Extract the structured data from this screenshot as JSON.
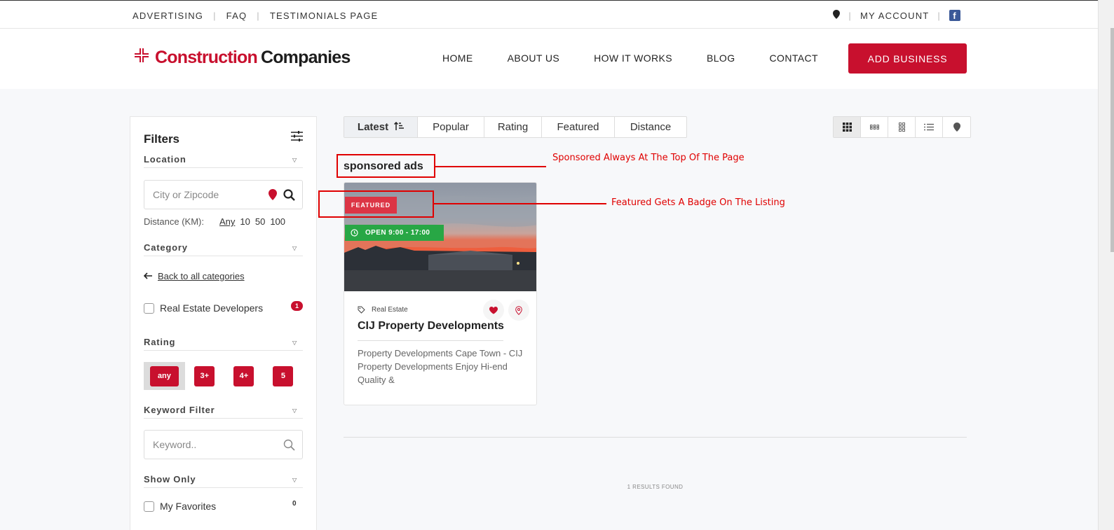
{
  "topbar": {
    "links": [
      "ADVERTISING",
      "FAQ",
      "TESTIMONIALS PAGE"
    ],
    "account_label": "MY ACCOUNT"
  },
  "header": {
    "logo_red": "Construction",
    "logo_dark": "Companies",
    "nav": [
      "HOME",
      "ABOUT US",
      "HOW IT WORKS",
      "BLOG",
      "CONTACT"
    ],
    "cta_label": "ADD BUSINESS"
  },
  "sidebar": {
    "title": "Filters",
    "location_label": "Location",
    "city_placeholder": "City or Zipcode",
    "distance_label": "Distance (KM):",
    "distance_options": [
      "Any",
      "10",
      "50",
      "100"
    ],
    "category_label": "Category",
    "back_label": "Back to all categories",
    "category_item": "Real Estate Developers",
    "category_count": "1",
    "rating_label": "Rating",
    "rating_options": [
      "any",
      "3+",
      "4+",
      "5"
    ],
    "keyword_label": "Keyword Filter",
    "keyword_placeholder": "Keyword..",
    "show_only_label": "Show Only",
    "favorites_label": "My Favorites",
    "favorites_count": "0"
  },
  "sort_tabs": [
    "Latest",
    "Popular",
    "Rating",
    "Featured",
    "Distance"
  ],
  "sponsored_heading": "sponsored ads",
  "listing": {
    "badge_featured": "FEATURED",
    "badge_open": "OPEN 9:00 - 17:00",
    "category": "Real Estate",
    "name": "CIJ Property Developments",
    "description": "Property Developments Cape Town - CIJ Property Developments Enjoy Hi-end Quality &"
  },
  "results_text": "1 RESULTS FOUND",
  "annotations": {
    "sponsored_note": "Sponsored Always At The Top Of The Page",
    "featured_note": "Featured Gets A Badge On The Listing"
  },
  "colors": {
    "brand_red": "#c8102e",
    "featured_badge": "#dc3545",
    "open_badge": "#28a745",
    "annotation_red": "#e00000"
  }
}
